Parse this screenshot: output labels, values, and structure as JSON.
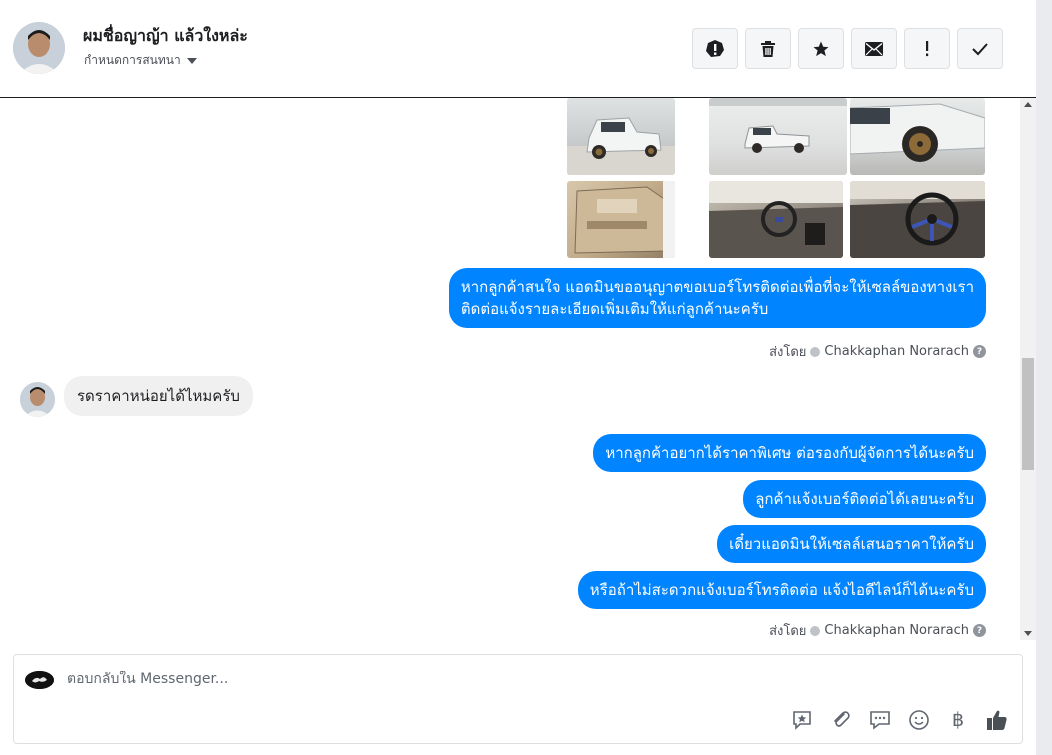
{
  "header": {
    "name": "ผมชื่อญาญ้า แล้วใงหล่ะ",
    "subtitle": "กำหนดการสนทนา",
    "actions": [
      {
        "icon": "alert-circle-icon",
        "label": "mark as spam"
      },
      {
        "icon": "trash-icon",
        "label": "delete"
      },
      {
        "icon": "star-icon",
        "label": "follow up"
      },
      {
        "icon": "envelope-icon",
        "label": "mark unread"
      },
      {
        "icon": "exclamation-icon",
        "label": "priority"
      },
      {
        "icon": "check-icon",
        "label": "done"
      }
    ]
  },
  "messages": {
    "photos": [
      "car-rear-three-quarter",
      "car-side",
      "car-front-wheel",
      "door-interior",
      "dashboard-steering",
      "steering-wheel"
    ],
    "out1": {
      "line1": "หากลูกค้าสนใจ แอดมินขออนุญาตขอเบอร์โทรติดต่อเพื่อที่จะให้เซลล์ของทางเรา",
      "line2": "ติดต่อแจ้งรายละเอียดเพิ่มเติมให้แก่ลูกค้านะครับ"
    },
    "sent_by_1": {
      "prefix": "ส่งโดย",
      "name": "Chakkaphan Norarach",
      "help": "?"
    },
    "in1": "รดราคาหน่อยได้ไหมครับ",
    "out2": "หากลูกค้าอยากได้ราคาพิเศษ ต่อรองกับผู้จัดการได้นะครับ",
    "out3": "ลูกค้าแจ้งเบอร์ติดต่อได้เลยนะครับ",
    "out4": "เดี๋ยวแอดมินให้เซลล์เสนอราคาให้ครับ",
    "out5": "หรือถ้าไม่สะดวกแจ้งเบอร์โทรติดต่อ แจ้งไอดีไลน์ก็ได้นะครับ",
    "sent_by_2": {
      "prefix": "ส่งโดย",
      "name": "Chakkaphan Norarach",
      "help": "?"
    }
  },
  "composer": {
    "placeholder": "ตอบกลับใน Messenger...",
    "tools": [
      "saved-reply-icon",
      "attachment-icon",
      "chat-bubble-icon",
      "emoji-icon",
      "baht-icon",
      "thumbs-up-icon"
    ],
    "baht_symbol": "฿"
  },
  "colors": {
    "accent": "#0084ff",
    "incoming_bubble": "#f1f0f0"
  }
}
